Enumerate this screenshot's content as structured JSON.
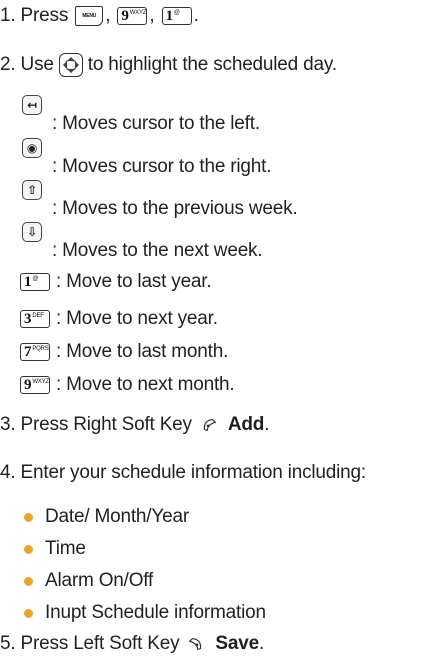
{
  "step1": {
    "num": "1.",
    "text": "Press",
    "sep1": ",",
    "sep2": ",",
    "end": ".",
    "menu_key": "MENU",
    "key_9": "9",
    "key_9_sub": "WXYZ",
    "key_1": "1",
    "key_1_sub": "@"
  },
  "step2": {
    "num": "2.",
    "before": "Use",
    "after": "to highlight the scheduled day."
  },
  "nav_items": [
    {
      "icon": "left-key",
      "text": ": Moves cursor to the left."
    },
    {
      "icon": "right-key",
      "text": ": Moves cursor to the right."
    },
    {
      "icon": "up-key",
      "text": ": Moves to the previous week."
    },
    {
      "icon": "down-key",
      "text": ": Moves to the next week."
    }
  ],
  "key_items": [
    {
      "key": "1",
      "sub": "@",
      "text": ": Move to last year."
    },
    {
      "key": "3",
      "sub": "DEF",
      "text": ": Move to next year."
    },
    {
      "key": "7",
      "sub": "PQRS",
      "text": ": Move to last month."
    },
    {
      "key": "9",
      "sub": "WXYZ",
      "text": ": Move to next month."
    }
  ],
  "step3": {
    "num": "3.",
    "text": "Press Right Soft Key",
    "bold": "Add",
    "end": "."
  },
  "step4": {
    "num": "4.",
    "text": "Enter your schedule information including:"
  },
  "bullets": [
    "Date/ Month/Year",
    "Time",
    "Alarm On/Off",
    "Inupt Schedule information"
  ],
  "step5": {
    "num": "5.",
    "text": "Press Left Soft Key",
    "bold": "Save",
    "end": "."
  },
  "colors": {
    "bullet": "#f0a12c",
    "text": "#231f20"
  }
}
